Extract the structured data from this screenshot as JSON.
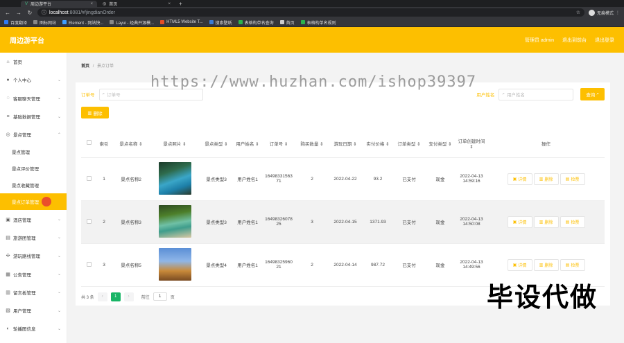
{
  "browser": {
    "tabs": [
      {
        "label": "周边游平台",
        "active": true
      },
      {
        "label": "首页",
        "active": false
      }
    ],
    "url_host": "localhost",
    "url_path": ":8081/#/jingdianOrder",
    "profile_label": "无痕模式",
    "bookmarks": [
      "百度翻译",
      "图标网站",
      "Element - 网站快...",
      "Layui - 经典开源模...",
      "HTML5 Website T...",
      "搜索壁纸",
      "表格构单名查询",
      "首页",
      "表格构单名规则"
    ]
  },
  "header": {
    "title": "周边游平台",
    "admin_label": "管理员 admin",
    "exit_to_front": "退出到前台",
    "logout": "退出登录"
  },
  "sidebar": {
    "items": [
      {
        "label": "首页",
        "icon": "home-icon"
      },
      {
        "label": "个人中心",
        "icon": "user-icon"
      },
      {
        "label": "客服聊天管理",
        "icon": "chat-icon"
      },
      {
        "label": "基础数据管理",
        "icon": "list-icon"
      },
      {
        "label": "景点管理",
        "icon": "location-icon"
      }
    ],
    "sub_items": [
      {
        "label": "景点管理",
        "active": false
      },
      {
        "label": "景点评价管理",
        "active": false
      },
      {
        "label": "景点收藏管理",
        "active": false
      },
      {
        "label": "景点订单管理",
        "active": true
      }
    ],
    "items_after": [
      {
        "label": "酒店管理",
        "icon": "hotel-icon"
      },
      {
        "label": "旅游团管理",
        "icon": "group-icon"
      },
      {
        "label": "游玩路线管理",
        "icon": "route-icon"
      },
      {
        "label": "公告管理",
        "icon": "notice-icon"
      },
      {
        "label": "留言板管理",
        "icon": "message-icon"
      },
      {
        "label": "用户管理",
        "icon": "users-icon"
      },
      {
        "label": "轮播图信息",
        "icon": "image-icon"
      }
    ]
  },
  "breadcrumb": {
    "home": "首页",
    "separator": "/",
    "current": "景点订单"
  },
  "search": {
    "order_label": "订单号",
    "order_placeholder": "订单号",
    "username_label": "用户姓名",
    "username_placeholder": "用户姓名",
    "query_button": "查询",
    "delete_button": "删除"
  },
  "table": {
    "headers": [
      "索引",
      "景点名称",
      "景点照片",
      "景点类型",
      "用户姓名",
      "订单号",
      "购买数量",
      "游玩日期",
      "实付价格",
      "订单类型",
      "支付类型",
      "订单创建时间",
      "操作"
    ],
    "rows": [
      {
        "index": "1",
        "name": "景点名称2",
        "type": "景点类型3",
        "user": "用户姓名1",
        "order_no": "1649833156371",
        "qty": "2",
        "date": "2022-04-22",
        "price": "93.2",
        "order_type": "已支付",
        "pay_type": "现金",
        "created": "2022-04-13 14:59:16",
        "photo": "photo-lake"
      },
      {
        "index": "2",
        "name": "景点名称3",
        "type": "景点类型3",
        "user": "用户姓名1",
        "order_no": "1649832607825",
        "qty": "3",
        "date": "2022-04-15",
        "price": "1371.93",
        "order_type": "已支付",
        "pay_type": "现金",
        "created": "2022-04-13 14:50:08",
        "photo": "photo-green"
      },
      {
        "index": "3",
        "name": "景点名称5",
        "type": "景点类型4",
        "user": "用户姓名1",
        "order_no": "1649832596021",
        "qty": "2",
        "date": "2022-04-14",
        "price": "987.72",
        "order_type": "已支付",
        "pay_type": "现金",
        "created": "2022-04-13 14:49:56",
        "photo": "photo-pagoda"
      }
    ],
    "actions": {
      "detail": "详情",
      "delete": "删除",
      "review": "检票"
    }
  },
  "pager": {
    "total": "共 3 条",
    "current": "1",
    "goto_label": "前往",
    "goto_value": "1",
    "page_unit": "页"
  },
  "overlay": {
    "watermark": "https://www.huzhan.com/ishop39397",
    "stamp": "毕设代做"
  },
  "colors": {
    "accent": "#fdbf00",
    "page_active": "#18b566"
  }
}
